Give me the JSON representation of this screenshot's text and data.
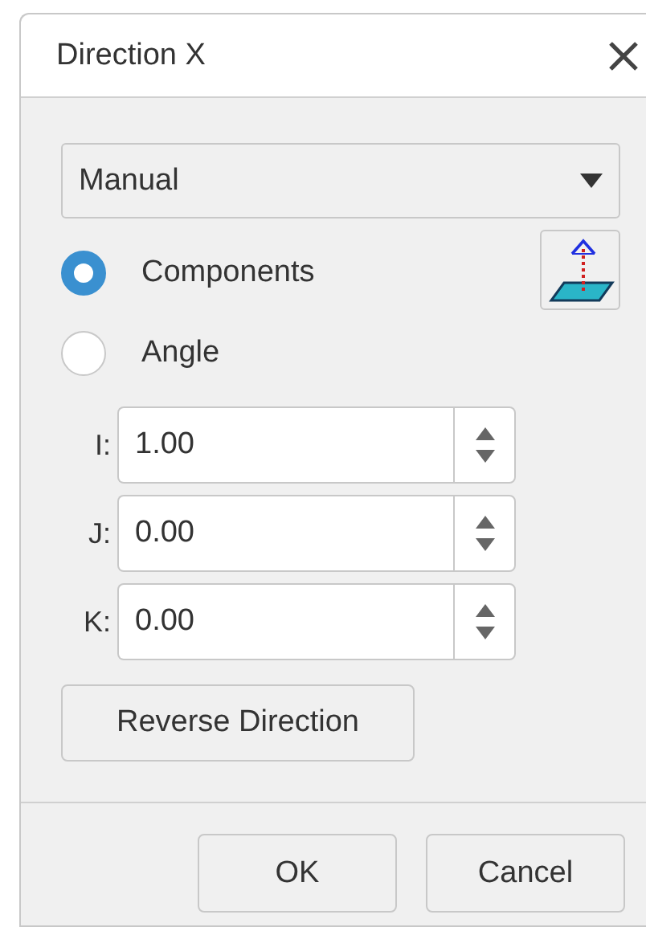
{
  "window": {
    "title": "Direction X"
  },
  "mode_dropdown": {
    "value": "Manual"
  },
  "radios": [
    {
      "label": "Components",
      "selected": true
    },
    {
      "label": "Angle",
      "selected": false
    }
  ],
  "components": [
    {
      "label": "I:",
      "value": "1.00"
    },
    {
      "label": "J:",
      "value": "0.00"
    },
    {
      "label": "K:",
      "value": "0.00"
    }
  ],
  "reverse_button": "Reverse Direction",
  "buttons": [
    "OK",
    "Cancel"
  ]
}
